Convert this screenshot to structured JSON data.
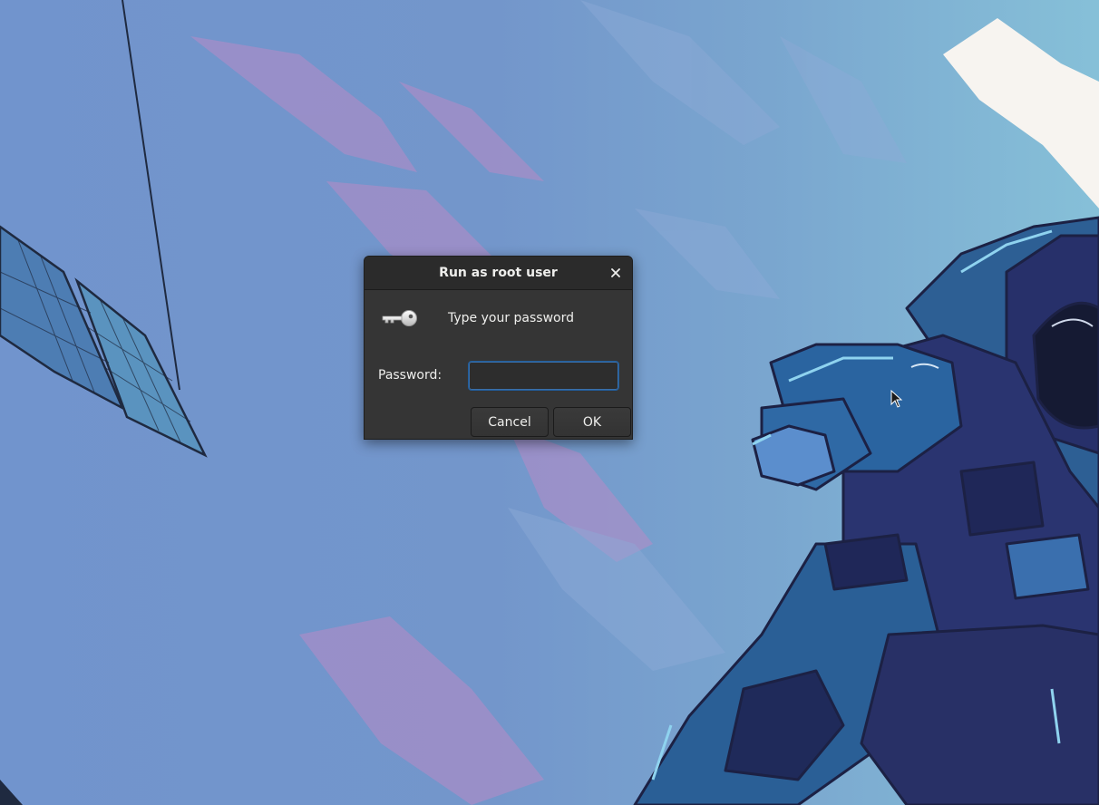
{
  "dialog": {
    "title": "Run as root user",
    "prompt": "Type your password",
    "password_label": "Password:",
    "password_value": "",
    "cancel_label": "Cancel",
    "ok_label": "OK",
    "icons": {
      "close": "close-icon",
      "key": "key-icon"
    }
  },
  "theme": {
    "dialog_bg": "#353535",
    "titlebar_bg": "#2b2b2b",
    "focus_accent": "#215d9c",
    "wallpaper_blue": "#7194cd",
    "wallpaper_teal": "#86c0d8"
  }
}
